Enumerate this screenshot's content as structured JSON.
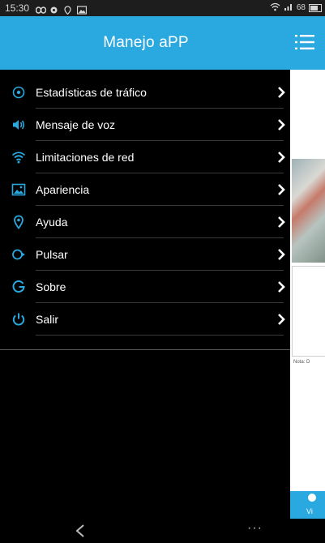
{
  "status_bar": {
    "time": "15:30",
    "battery": "68"
  },
  "header": {
    "title": "Manejo aPP",
    "menu_icon": "hamburger-icon"
  },
  "menu": {
    "items": [
      {
        "label": "Estadísticas de tráfico",
        "icon": "traffic-stats-icon"
      },
      {
        "label": "Mensaje de voz",
        "icon": "speaker-icon"
      },
      {
        "label": "Limitaciones de red",
        "icon": "wifi-icon"
      },
      {
        "label": "Apariencia",
        "icon": "image-icon"
      },
      {
        "label": "Ayuda",
        "icon": "location-pin-icon"
      },
      {
        "label": "Pulsar",
        "icon": "play-circle-icon"
      },
      {
        "label": "Sobre",
        "icon": "g-icon"
      },
      {
        "label": "Salir",
        "icon": "power-icon"
      }
    ]
  },
  "background_app": {
    "note_text": "Nota: D",
    "bottom_label": "Vi"
  },
  "nav_bar": {
    "back_icon": "back-arrow-icon",
    "more_label": "···"
  },
  "colors": {
    "accent": "#2aa8e0",
    "drawer_bg": "#000000",
    "text": "#ffffff"
  }
}
